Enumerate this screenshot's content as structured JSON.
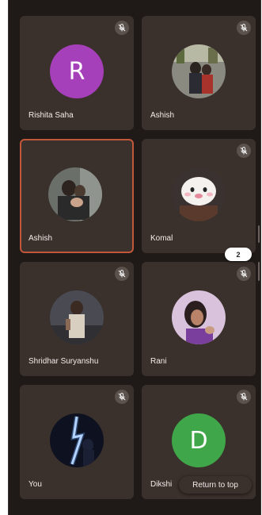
{
  "colors": {
    "stage_bg": "#1f1a18",
    "tile_bg": "#3a302c",
    "active_border": "#c0573a",
    "mute_bg": "#5b514d",
    "avatar_purple": "#a53fba",
    "avatar_green": "#3fa64a"
  },
  "participants": [
    {
      "name": "Rishita Saha",
      "initial": "R",
      "avatar_color": "#a53fba",
      "avatar": "initial-avatar",
      "muted": true
    },
    {
      "name": "Ashish",
      "initial": "",
      "avatar": "photo-avatar",
      "muted": true
    },
    {
      "name": "Ashish",
      "initial": "",
      "avatar": "photo-avatar",
      "muted": false,
      "active": true
    },
    {
      "name": "Komal",
      "initial": "",
      "avatar": "photo-avatar",
      "muted": true
    },
    {
      "name": "Shridhar Suryanshu",
      "initial": "",
      "avatar": "photo-avatar",
      "muted": true
    },
    {
      "name": "Rani",
      "initial": "",
      "avatar": "photo-avatar",
      "muted": true
    },
    {
      "name": "You",
      "initial": "",
      "avatar": "photo-avatar",
      "muted": true
    },
    {
      "name": "Dikshi",
      "initial": "D",
      "avatar_color": "#3fa64a",
      "avatar": "initial-avatar",
      "muted": true
    }
  ],
  "page_badge": "2",
  "return_to_top": "Return to top"
}
